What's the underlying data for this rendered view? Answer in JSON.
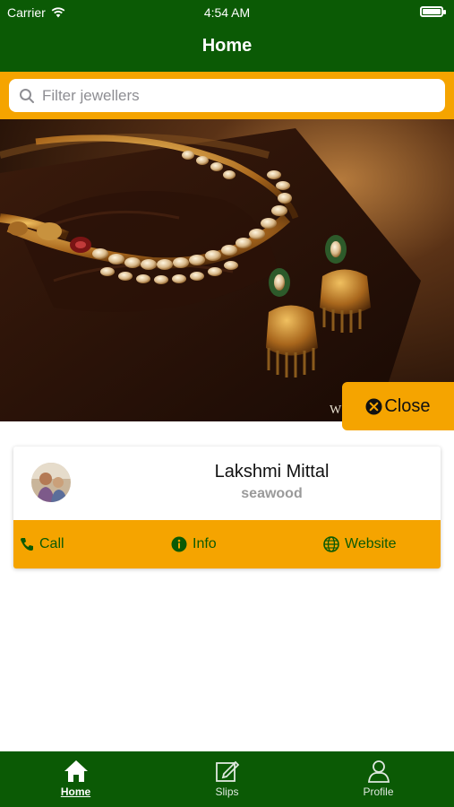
{
  "status_bar": {
    "carrier": "Carrier",
    "time": "4:54 AM"
  },
  "header": {
    "title": "Home"
  },
  "search": {
    "placeholder": "Filter jewellers",
    "value": ""
  },
  "banner": {
    "watermark": "W"
  },
  "close_button": {
    "label": "Close"
  },
  "jeweller": {
    "name": "Lakshmi Mittal",
    "location": "seawood",
    "actions": {
      "call": "Call",
      "info": "Info",
      "website": "Website"
    }
  },
  "tabs": [
    {
      "label": "Home",
      "icon": "home-icon",
      "active": true
    },
    {
      "label": "Slips",
      "icon": "edit-note-icon",
      "active": false
    },
    {
      "label": "Profile",
      "icon": "person-icon",
      "active": false
    }
  ],
  "colors": {
    "primary_green": "#0b5a05",
    "accent_orange": "#f5a400"
  }
}
